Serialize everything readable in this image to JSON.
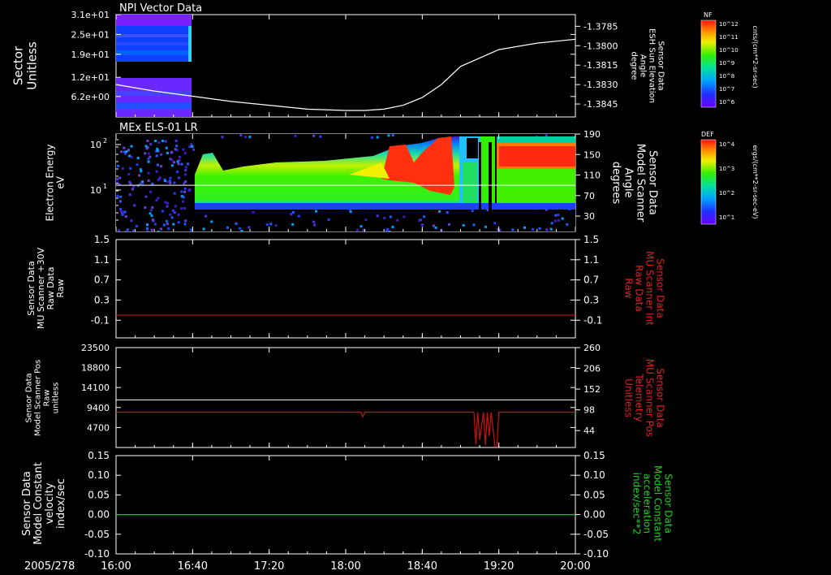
{
  "chart_data": [
    {
      "type": "heatmap",
      "title": "NPI Vector Data",
      "ylabel": "Sector Unitless",
      "yticks": [
        "3.1e+01",
        "2.5e+01",
        "1.9e+01",
        "1.2e+01",
        "6.2e+00"
      ],
      "ytick_values": [
        31,
        25,
        19,
        12,
        6.2
      ],
      "ylim": [
        0,
        31
      ],
      "y2label": [
        "Sensor Data",
        "ESH Sun Elevation",
        "Angle",
        "degree"
      ],
      "y2ticks": [
        "-1.3785",
        "-1.3800",
        "-1.3815",
        "-1.3830",
        "-1.3845"
      ],
      "y2tick_values": [
        -1.3785,
        -1.38,
        -1.3815,
        -1.383,
        -1.3845
      ],
      "y2lim": [
        -1.3855,
        -1.3776
      ],
      "line_series": {
        "color": "#ffffff",
        "x": [
          "16:00",
          "16:20",
          "16:40",
          "17:00",
          "17:20",
          "17:40",
          "18:00",
          "18:10",
          "18:20",
          "18:30",
          "18:40",
          "18:50",
          "19:00",
          "19:20",
          "19:40",
          "20:00"
        ],
        "y": [
          -1.383,
          -1.3835,
          -1.3839,
          -1.3843,
          -1.3846,
          -1.3849,
          -1.385,
          -1.385,
          -1.3849,
          -1.3846,
          -1.384,
          -1.383,
          -1.3816,
          -1.3803,
          -1.3798,
          -1.3795
        ]
      },
      "data_coverage": [
        "16:00",
        "16:40"
      ],
      "colorbar": {
        "label": "NF",
        "units": "cnts/(cm**2-sr-sec)",
        "ticks": [
          "10^12",
          "10^11",
          "10^10",
          "10^9",
          "10^8",
          "10^7",
          "10^6"
        ]
      }
    },
    {
      "type": "heatmap",
      "title": "MEx ELS-01 LR",
      "ylabel": [
        "Electron Energy",
        "eV"
      ],
      "yticks": [
        "10^2",
        "10^1"
      ],
      "scale": "log",
      "y2label": [
        "Sensor Data",
        "Model Scanner",
        "Angle",
        "degrees"
      ],
      "y2ticks": [
        "190",
        "150",
        "110",
        "70",
        "30"
      ],
      "y2tick_values": [
        190,
        150,
        110,
        70,
        30
      ],
      "y2lim": [
        0,
        190
      ],
      "line_series": {
        "color": "#ffffff",
        "value": 90
      },
      "colorbar": {
        "label": "DEF",
        "units": "ergs/(cm**2-sr-sec-eV)",
        "ticks": [
          "10^4",
          "10^3",
          "10^2",
          "10^1"
        ]
      }
    },
    {
      "type": "line",
      "ylabel": [
        "Sensor Data",
        "MU Scanner +30V",
        "Raw Data",
        "Raw"
      ],
      "yticks": [
        "1.5",
        "1.1",
        "0.7",
        "0.3",
        "-0.1"
      ],
      "ytick_values": [
        1.5,
        1.1,
        0.7,
        0.3,
        -0.1
      ],
      "ylim": [
        -0.45,
        1.5
      ],
      "y2label": [
        "Sensor Data",
        "MU Scanner Int",
        "Raw Data",
        "Raw"
      ],
      "y2ticks": [
        "1.5",
        "1.1",
        "0.7",
        "0.3",
        "-0.1"
      ],
      "series": [
        {
          "color": "#d01010",
          "x": [
            "16:00",
            "20:00"
          ],
          "y": [
            0,
            0
          ]
        }
      ]
    },
    {
      "type": "line",
      "ylabel": [
        "Sensor Data",
        "Model Scanner Pos",
        "Raw",
        "unitless"
      ],
      "yticks": [
        "23500",
        "18800",
        "14100",
        "9400",
        "4700"
      ],
      "ytick_values": [
        23500,
        18800,
        14100,
        9400,
        4700
      ],
      "ylim": [
        0,
        23500
      ],
      "y2label": [
        "Sensor Data",
        "MU Scanner Pos",
        "Telemetry",
        "Unitless"
      ],
      "y2ticks": [
        "260",
        "206",
        "152",
        "98",
        "44"
      ],
      "y2tick_values": [
        260,
        206,
        152,
        98,
        44
      ],
      "y2lim": [
        0,
        260
      ],
      "series": [
        {
          "color": "#ffffff",
          "axis": "left",
          "x": [
            "16:00",
            "20:00"
          ],
          "y": [
            11200,
            11200
          ]
        },
        {
          "color": "#d01010",
          "axis": "right",
          "x": [
            "16:00",
            "18:08",
            "18:09",
            "18:10",
            "19:07",
            "19:08",
            "19:09",
            "19:10",
            "19:12",
            "19:13",
            "19:14",
            "19:15",
            "19:16",
            "19:18",
            "19:19",
            "19:20",
            "20:00"
          ],
          "y": [
            92,
            92,
            80,
            92,
            92,
            8,
            92,
            20,
            92,
            6,
            92,
            30,
            92,
            2,
            2,
            92,
            92
          ]
        }
      ]
    },
    {
      "type": "line",
      "ylabel": [
        "Sensor Data",
        "Model Constant",
        "velocity",
        "index/sec"
      ],
      "yticks": [
        "0.15",
        "0.10",
        "0.05",
        "0.00",
        "-0.05",
        "-0.10"
      ],
      "ytick_values": [
        0.15,
        0.1,
        0.05,
        0.0,
        -0.05,
        -0.1
      ],
      "ylim": [
        -0.1,
        0.15
      ],
      "y2label": [
        "Sensor Data",
        "Model Constant",
        "acceleration",
        "index/sec**2"
      ],
      "y2ticks": [
        "0.15",
        "0.10",
        "0.05",
        "0.00",
        "-0.05",
        "-0.10"
      ],
      "series": [
        {
          "color": "#20c020",
          "x": [
            "16:00",
            "20:00"
          ],
          "y": [
            0,
            0
          ]
        }
      ]
    }
  ],
  "xaxis": {
    "date_label": "2005/278",
    "ticks": [
      "16:00",
      "16:40",
      "17:20",
      "18:00",
      "18:40",
      "19:20",
      "20:00"
    ],
    "range": [
      "16:00",
      "20:00"
    ]
  }
}
